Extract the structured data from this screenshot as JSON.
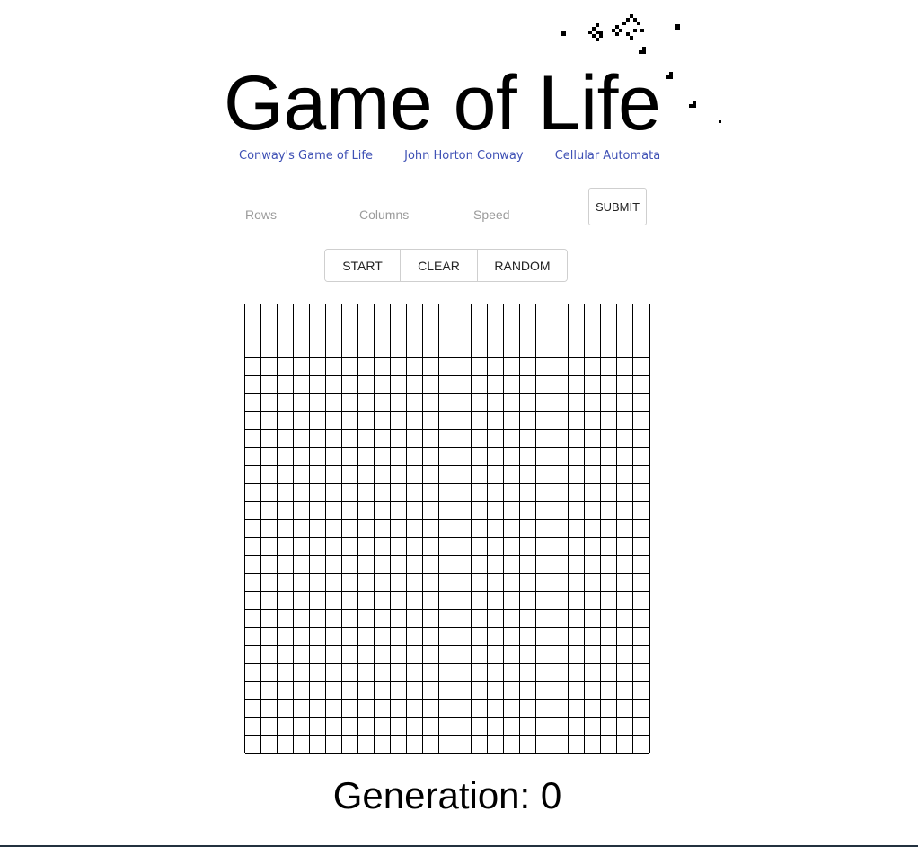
{
  "header": {
    "title": "Game of Life"
  },
  "links": [
    {
      "label": "Conway's Game of Life"
    },
    {
      "label": "John Horton Conway"
    },
    {
      "label": "Cellular Automata"
    }
  ],
  "form": {
    "rows_placeholder": "Rows",
    "columns_placeholder": "Columns",
    "speed_placeholder": "Speed",
    "submit_label": "SUBMIT"
  },
  "controls": {
    "start_label": "START",
    "clear_label": "CLEAR",
    "random_label": "RANDOM"
  },
  "board": {
    "rows": 25,
    "columns": 25,
    "live_cells": []
  },
  "status": {
    "generation_label": "Generation:",
    "generation_value": "0"
  },
  "colors": {
    "link": "#3f51b5",
    "grid_line": "#000000",
    "live_cell": "#000000",
    "footer_border": "#23313f"
  },
  "icons": {
    "title_decoration": "glider-pattern-icon"
  }
}
